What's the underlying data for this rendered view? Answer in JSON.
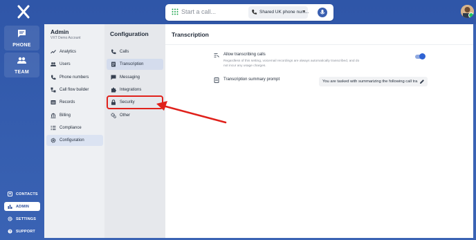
{
  "topbar": {
    "call_placeholder": "Start a call...",
    "phone_number_label": "Shared UK phone num...",
    "caret": "▾"
  },
  "rail": {
    "phone_label": "PHONE",
    "team_label": "TEAM",
    "bottom": [
      {
        "label": "CONTACTS"
      },
      {
        "label": "ADMIN"
      },
      {
        "label": "SETTINGS"
      },
      {
        "label": "SUPPORT"
      }
    ]
  },
  "admin": {
    "title": "Admin",
    "subtitle": "VXT Demo Account",
    "items": [
      {
        "label": "Analytics",
        "icon": "analytics-icon"
      },
      {
        "label": "Users",
        "icon": "users-icon"
      },
      {
        "label": "Phone numbers",
        "icon": "phone-icon"
      },
      {
        "label": "Call flow builder",
        "icon": "call-flow-icon"
      },
      {
        "label": "Records",
        "icon": "records-icon"
      },
      {
        "label": "Billing",
        "icon": "billing-icon"
      },
      {
        "label": "Compliance",
        "icon": "compliance-icon"
      },
      {
        "label": "Configuration",
        "icon": "gear-icon"
      }
    ]
  },
  "config": {
    "title": "Configuration",
    "items": [
      {
        "label": "Calls",
        "icon": "phone-icon"
      },
      {
        "label": "Transcription",
        "icon": "transcript-icon"
      },
      {
        "label": "Messaging",
        "icon": "message-icon"
      },
      {
        "label": "Integrations",
        "icon": "puzzle-icon"
      },
      {
        "label": "Security",
        "icon": "lock-icon"
      },
      {
        "label": "Other",
        "icon": "gears-icon"
      }
    ]
  },
  "main": {
    "title": "Transcription",
    "allow_title": "Allow transcribing calls",
    "allow_desc": "Regardless of this setting, voicemail recordings are always automatically transcribed, and do not incur any usage charges.",
    "summary_title": "Transcription summary prompt",
    "summary_value": "You are tasked with summarizing the following call tra..."
  },
  "colors": {
    "brand_blue": "#3457a4",
    "highlight_red": "#e0211b",
    "toggle_on": "#2f63d3"
  }
}
